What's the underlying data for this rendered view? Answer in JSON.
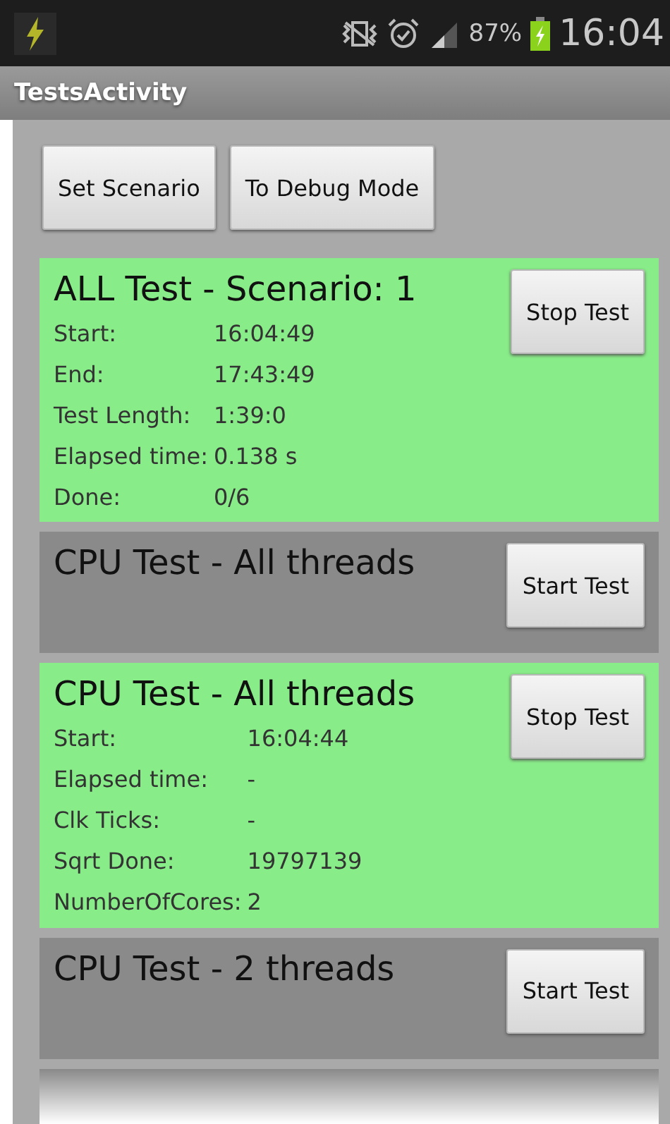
{
  "status_bar": {
    "battery": "87%",
    "time": "16:04"
  },
  "app_bar": {
    "title": "TestsActivity"
  },
  "buttons": [
    "Set Scenario",
    "To Debug Mode"
  ],
  "tests": [
    {
      "title": "ALL Test - Scenario: 1",
      "running": true,
      "button": "Stop Test",
      "rows": [
        {
          "label": "Start:",
          "value": "16:04:49"
        },
        {
          "label": "End:",
          "value": "17:43:49"
        },
        {
          "label": "Test Length:",
          "value": "1:39:0"
        },
        {
          "label": "Elapsed time:",
          "value": "0.138 s"
        },
        {
          "label": "Done:",
          "value": "0/6"
        }
      ]
    },
    {
      "title": "CPU Test - All threads",
      "running": false,
      "button": "Start Test"
    },
    {
      "title": "CPU Test - All threads",
      "running": true,
      "button": "Stop Test",
      "rows": [
        {
          "label": "Start:",
          "value": "16:04:44"
        },
        {
          "label": "Elapsed time:",
          "value": "-"
        },
        {
          "label": "Clk Ticks:",
          "value": "-"
        },
        {
          "label": "Sqrt Done:",
          "value": "19797139"
        },
        {
          "label": "NumberOfCores:",
          "value": "2"
        }
      ]
    },
    {
      "title": "CPU Test - 2 threads",
      "running": false,
      "button": "Start Test"
    }
  ]
}
